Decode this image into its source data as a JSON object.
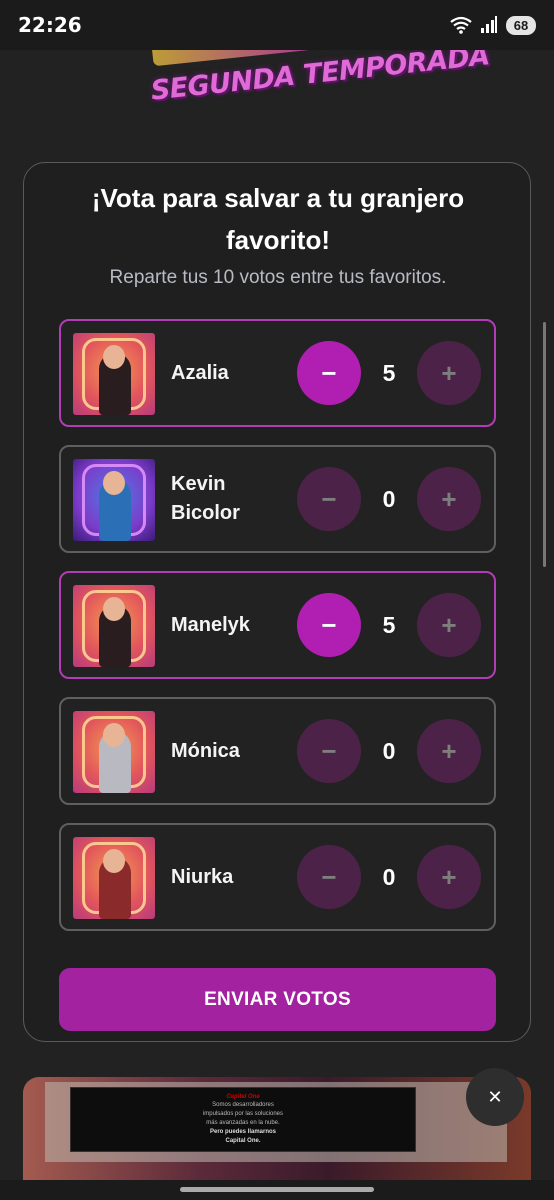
{
  "status_bar": {
    "time": "22:26",
    "battery": "68"
  },
  "header": {
    "logo_text": "SEGUNDA TEMPORADA"
  },
  "card": {
    "title": "¡Vota para salvar a tu granjero favorito!",
    "subtitle": "Reparte tus 10 votos entre tus favoritos.",
    "contestants": [
      {
        "name": "Azalia",
        "votes": "5",
        "minus": "−",
        "plus": "+"
      },
      {
        "name": "Kevin Bicolor",
        "votes": "0",
        "minus": "−",
        "plus": "+"
      },
      {
        "name": "Manelyk",
        "votes": "5",
        "minus": "−",
        "plus": "+"
      },
      {
        "name": "Mónica",
        "votes": "0",
        "minus": "−",
        "plus": "+"
      },
      {
        "name": "Niurka",
        "votes": "0",
        "minus": "−",
        "plus": "+"
      }
    ],
    "submit_label": "ENVIAR VOTOS"
  },
  "ad": {
    "logo": "Capital One",
    "line1": "Somos desarrolladores",
    "line2": "impulsados por las soluciones",
    "line3": "más avanzadas en la nube.",
    "line4": "Pero puedes llamarnos",
    "line5": "Capital One.",
    "close": "✕"
  },
  "colors": {
    "accent": "#b01fb1",
    "button_off": "#4d2248",
    "submit": "#a3229f"
  }
}
